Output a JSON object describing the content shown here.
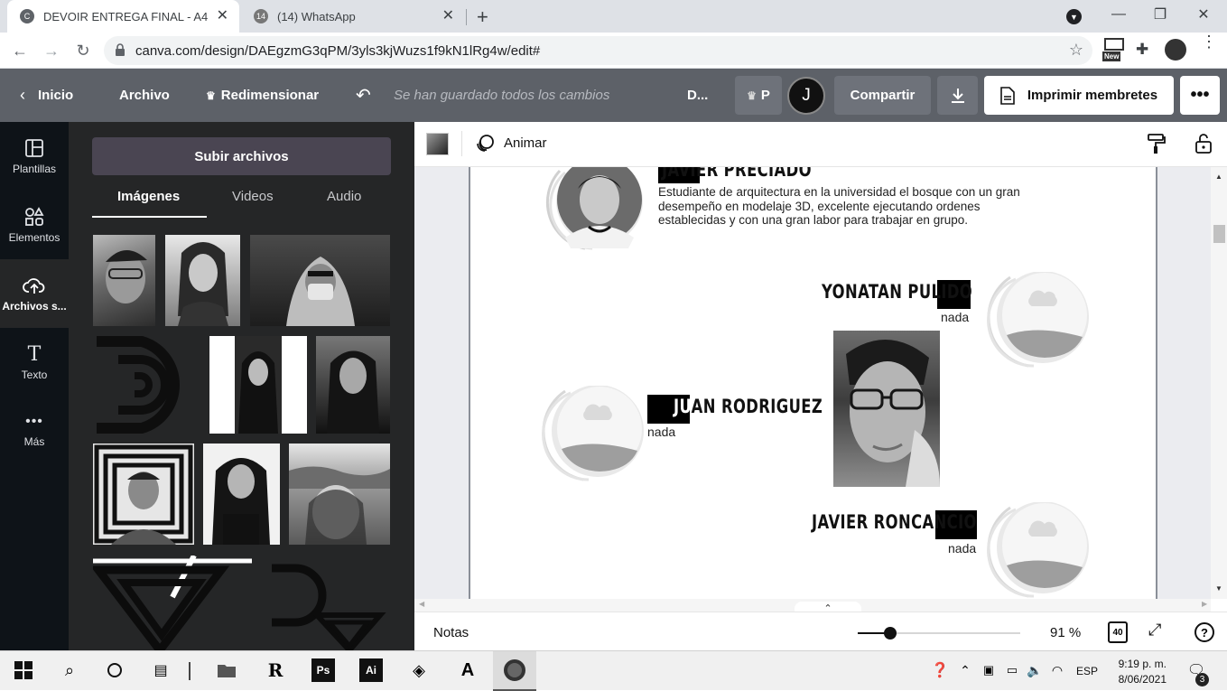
{
  "browser": {
    "tabs": [
      {
        "title": "DEVOIR ENTREGA FINAL - A4",
        "favicon": "C",
        "active": true
      },
      {
        "title": "(14) WhatsApp",
        "favicon": "14",
        "active": false
      }
    ],
    "url": "canva.com/design/DAEgzmG3qPM/3yls3kjWuzs1f9kN1lRg4w/edit#",
    "new_badge": "New"
  },
  "canva_header": {
    "home": "Inicio",
    "file": "Archivo",
    "resize": "Redimensionar",
    "saved_status": "Se han guardado todos los cambios",
    "doc_short": "D...",
    "pro_letter": "P",
    "avatar_letter": "J",
    "share": "Compartir",
    "print": "Imprimir membretes",
    "accent": "#5d6168"
  },
  "sidebar": {
    "items": [
      {
        "label": "Plantillas",
        "icon": "templates-icon"
      },
      {
        "label": "Elementos",
        "icon": "elements-icon"
      },
      {
        "label": "Archivos s...",
        "icon": "upload-cloud-icon"
      },
      {
        "label": "Texto",
        "icon": "text-icon"
      },
      {
        "label": "Más",
        "icon": "more-dots-icon"
      }
    ]
  },
  "panel": {
    "upload_button": "Subir archivos",
    "tabs": [
      "Imágenes",
      "Videos",
      "Audio"
    ]
  },
  "editor_toolbar": {
    "animate": "Animar"
  },
  "design": {
    "persons": [
      {
        "name": "JAVIER PRECIADO",
        "description_lines": [
          "Estudiante de arquitectura en la universidad el bosque con un gran",
          "desempeño en modelaje 3D, excelente ejecutando ordenes",
          "establecidas y con una gran labor para trabajar en grupo."
        ]
      },
      {
        "name": "YONATAN PULIDO",
        "subtitle": "nada"
      },
      {
        "name": "JUAN RODRIGUEZ",
        "subtitle": "nada"
      },
      {
        "name": "JAVIER RONCANCIO",
        "subtitle": "nada"
      }
    ]
  },
  "bottom_bar": {
    "notes": "Notas",
    "zoom": "91 %",
    "zoom_fraction": 0.2,
    "page_count": "40"
  },
  "taskbar": {
    "time": "9:19 p. m.",
    "date": "8/06/2021",
    "language": "ESP",
    "notifications": "3"
  }
}
